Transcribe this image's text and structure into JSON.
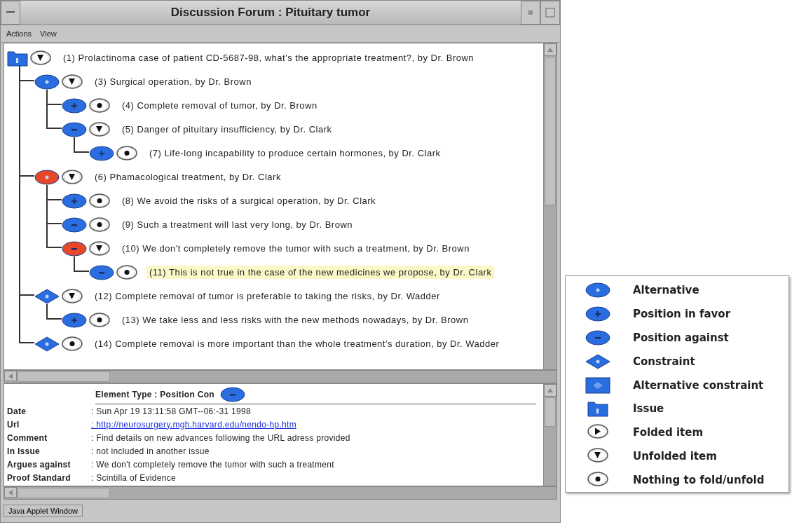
{
  "window": {
    "title": "Discussion Forum : Pituitary tumor",
    "status": "Java Applet Window"
  },
  "menu": [
    "Actions",
    "View"
  ],
  "tree": [
    {
      "kind": "issue",
      "color": "#2a6de0",
      "expanded": true,
      "selected": false,
      "text": "(1)  Prolactinoma case of patient CD-5687-98, what's the appropriate treatment?, by Dr. Brown",
      "children": [
        {
          "kind": "alternative",
          "color": "#2a6de0",
          "expanded": true,
          "selected": false,
          "text": "(3)  Surgical operation, by Dr. Brown",
          "children": [
            {
              "kind": "pro",
              "color": "#2a6de0",
              "selected": false,
              "text": "(4)  Complete removal of tumor, by Dr. Brown"
            },
            {
              "kind": "con",
              "color": "#2a6de0",
              "expanded": true,
              "selected": false,
              "text": "(5)  Danger of pituitary insufficiency, by Dr. Clark",
              "children": [
                {
                  "kind": "pro",
                  "color": "#2a6de0",
                  "selected": false,
                  "text": "(7)  Life-long incapability to produce certain hormones, by Dr. Clark"
                }
              ]
            }
          ]
        },
        {
          "kind": "alternative",
          "color": "#e8482a",
          "expanded": true,
          "selected": false,
          "text": "(6)  Phamacological treatment, by Dr. Clark",
          "children": [
            {
              "kind": "pro",
              "color": "#2a6de0",
              "selected": false,
              "text": "(8)  We avoid the risks of a surgical operation, by Dr. Clark"
            },
            {
              "kind": "con",
              "color": "#2a6de0",
              "selected": false,
              "text": "(9)  Such a treatment will last very long, by Dr. Brown"
            },
            {
              "kind": "con",
              "color": "#e8482a",
              "expanded": true,
              "selected": false,
              "text": "(10)  We don't completely remove the tumor with such a treatment, by Dr. Brown",
              "children": [
                {
                  "kind": "con",
                  "color": "#2a6de0",
                  "selected": true,
                  "text": "(11)  This is not true in the case of the new medicines we propose, by Dr. Clark"
                }
              ]
            }
          ]
        },
        {
          "kind": "constraint",
          "color": "#2a6de0",
          "expanded": true,
          "selected": false,
          "text": "(12)  Complete removal of tumor is preferable to taking the risks, by Dr. Wadder",
          "children": [
            {
              "kind": "pro",
              "color": "#2a6de0",
              "selected": false,
              "text": "(13)  We take less and less risks with the new methods nowadays, by Dr. Brown"
            }
          ]
        },
        {
          "kind": "constraint",
          "color": "#2a6de0",
          "selected": false,
          "text": "(14)  Complete removal is more important than the whole treatment's duration, by Dr. Wadder"
        }
      ]
    }
  ],
  "detail": {
    "element_type": "Element Type : Position Con",
    "element_icon": {
      "kind": "con"
    },
    "fields": [
      {
        "label": "Date",
        "value": ": Sun Apr 19 13:11:58 GMT--06:-31 1998",
        "kind": "text"
      },
      {
        "label": "Url",
        "value": ": http://neurosurgery.mgh.harvard.edu/nendo-hp.htm",
        "kind": "link"
      },
      {
        "label": "Comment",
        "value": ": Find details on new advances following the URL adress provided",
        "kind": "text"
      },
      {
        "label": "In Issue",
        "value": ": not included in another issue",
        "kind": "text"
      },
      {
        "label": "Argues against",
        "value": ": We don't completely remove the tumor with such a treatment",
        "kind": "text"
      },
      {
        "label": "Proof Standard",
        "value": ": Scintilla of Evidence",
        "kind": "text"
      }
    ]
  },
  "legend": [
    {
      "kind": "alternative",
      "label": "Alternative"
    },
    {
      "kind": "pro",
      "label": "Position in favor"
    },
    {
      "kind": "con",
      "label": "Position against"
    },
    {
      "kind": "constraint",
      "label": "Constraint"
    },
    {
      "kind": "alt_constraint",
      "label": "Alternative constraint"
    },
    {
      "kind": "issue",
      "label": "Issue"
    },
    {
      "kind": "folded",
      "label": "Folded item"
    },
    {
      "kind": "unfolded",
      "label": "Unfolded item"
    },
    {
      "kind": "none",
      "label": "Nothing to fold/unfold"
    }
  ]
}
